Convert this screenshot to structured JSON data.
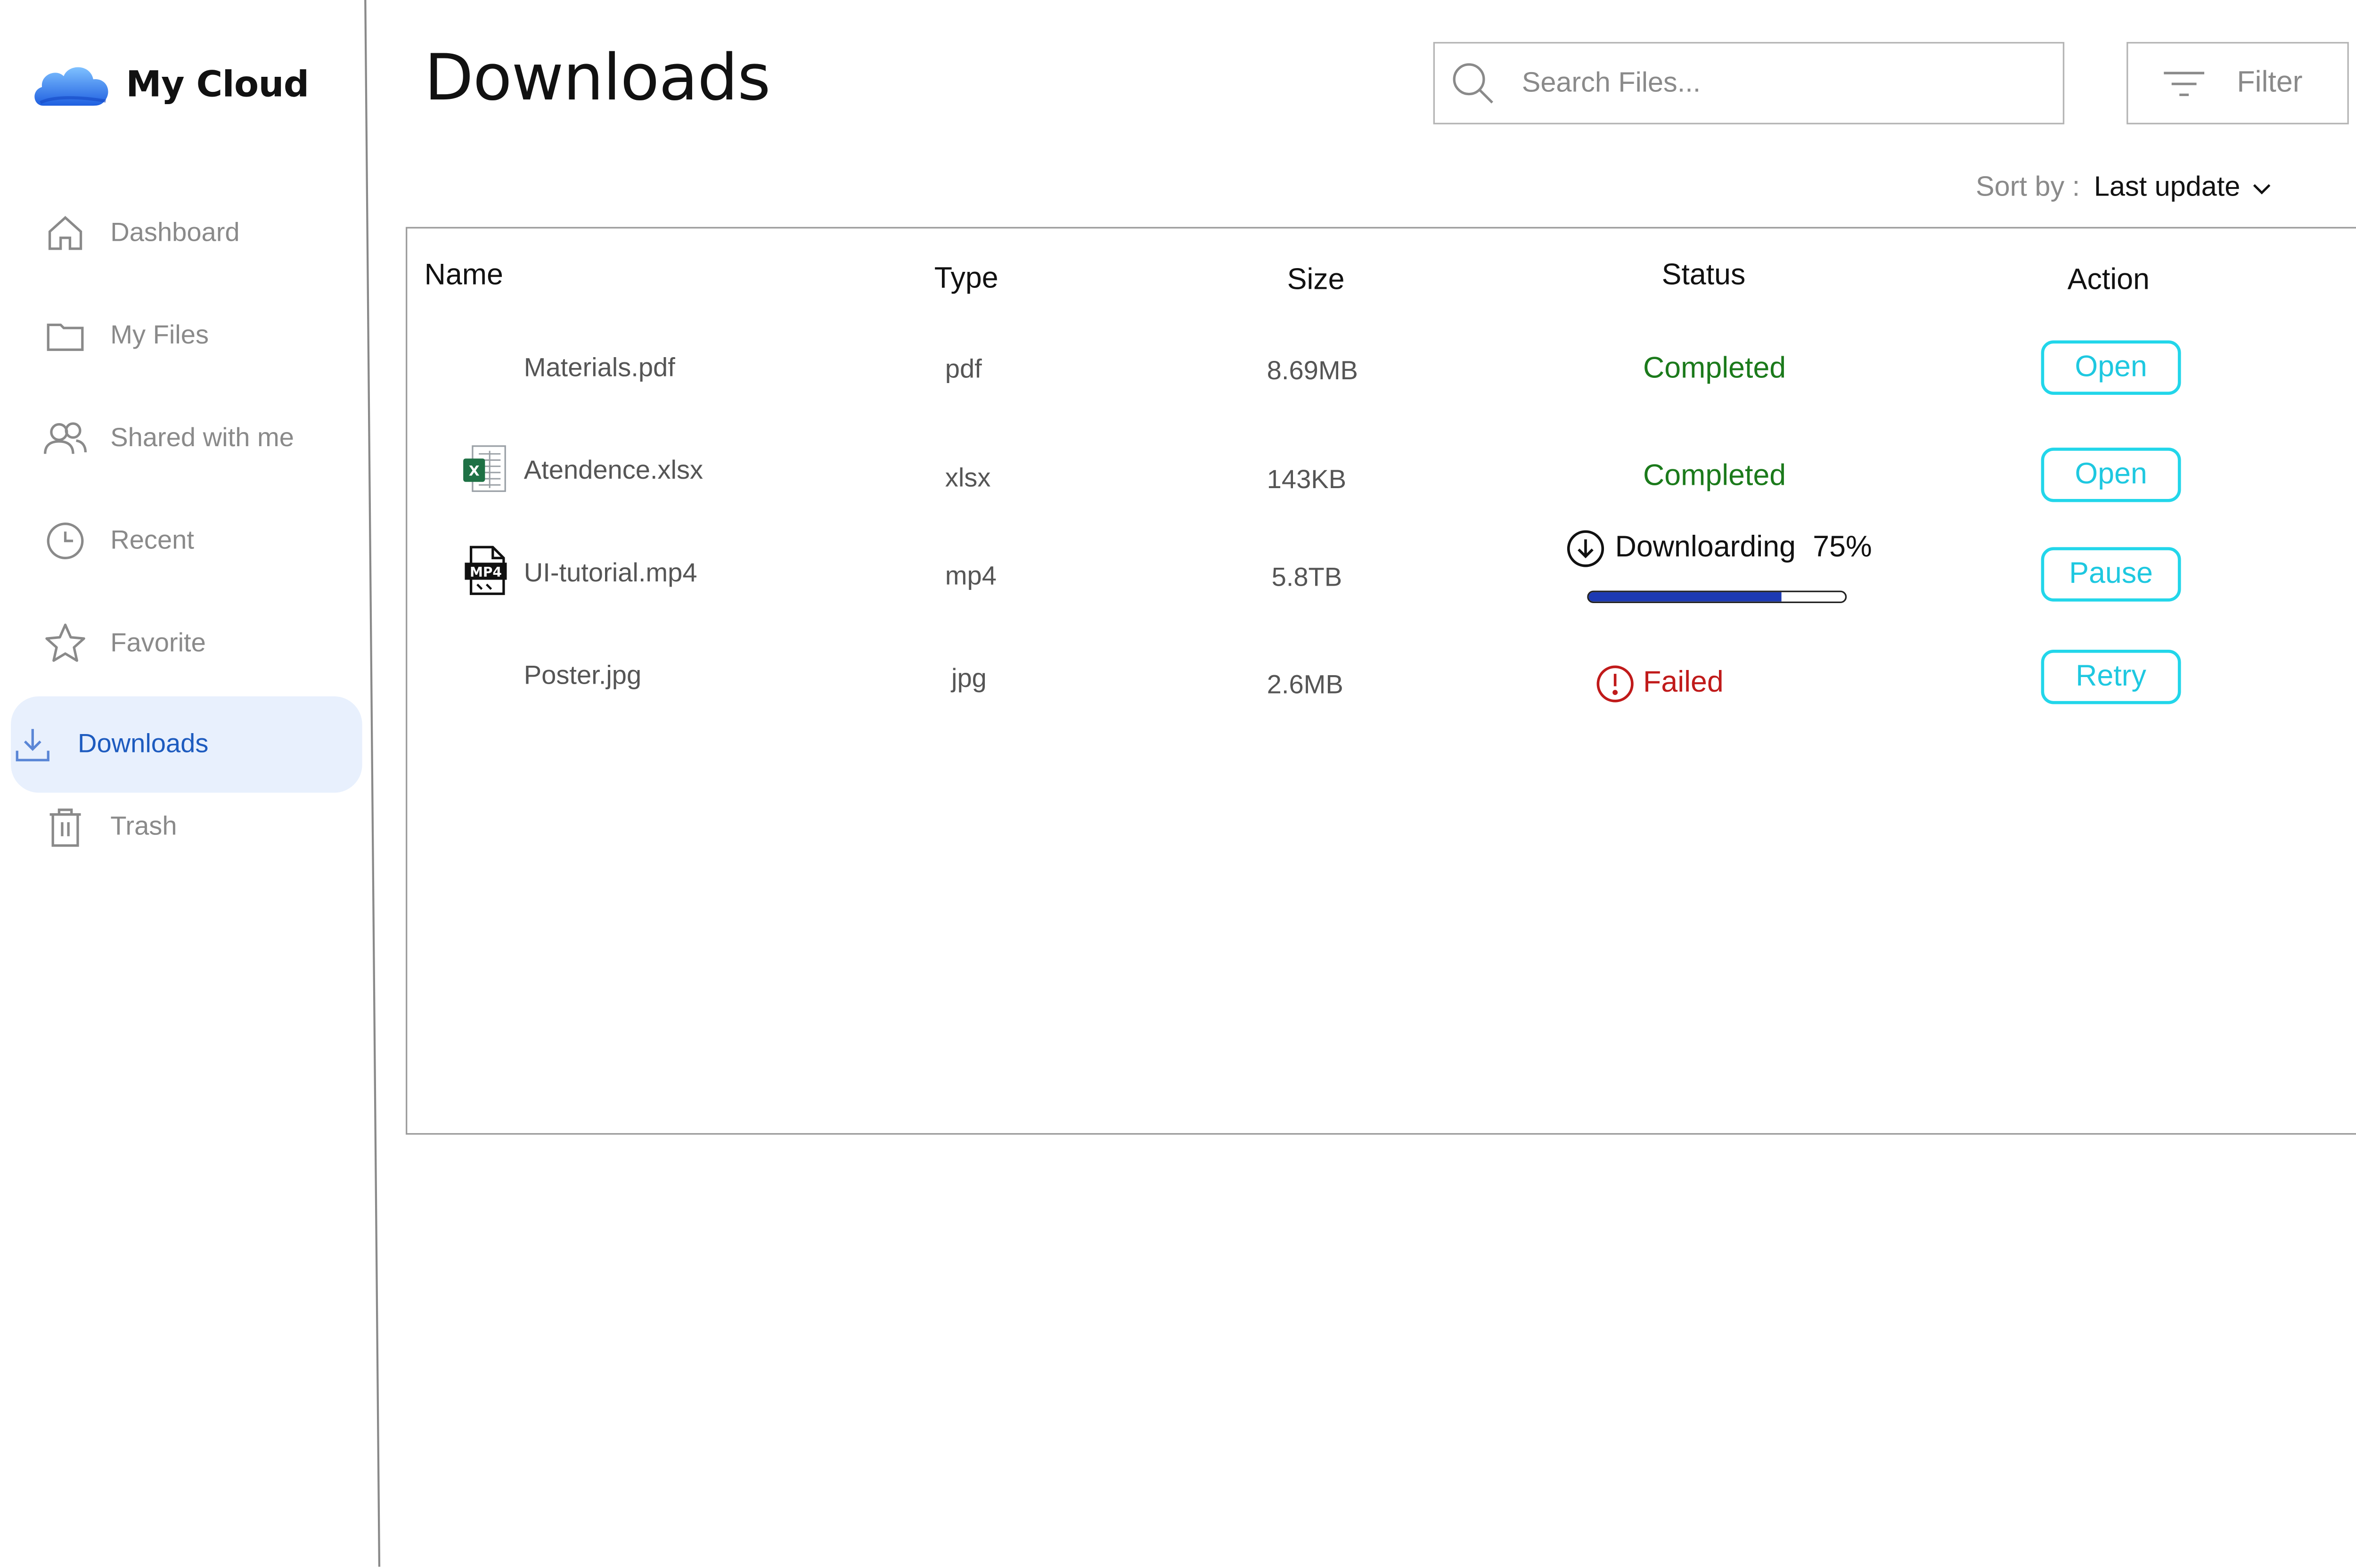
{
  "app": {
    "name": "My Cloud"
  },
  "sidebar": {
    "items": [
      {
        "label": "Dashboard",
        "icon": "home-icon",
        "active": false
      },
      {
        "label": "My Files",
        "icon": "folder-icon",
        "active": false
      },
      {
        "label": "Shared with me",
        "icon": "users-icon",
        "active": false
      },
      {
        "label": "Recent",
        "icon": "clock-icon",
        "active": false
      },
      {
        "label": "Favorite",
        "icon": "star-icon",
        "active": false
      },
      {
        "label": "Downloads",
        "icon": "download-icon",
        "active": true
      },
      {
        "label": "Trash",
        "icon": "trash-icon",
        "active": false
      }
    ]
  },
  "header": {
    "title": "Downloads",
    "search": {
      "placeholder": "Search Files...",
      "value": ""
    },
    "filter_label": "Filter",
    "sort": {
      "label": "Sort by :",
      "value": "Last update"
    }
  },
  "table": {
    "columns": [
      "Name",
      "Type",
      "Size",
      "Status",
      "Action"
    ],
    "rows": [
      {
        "name": "Materials.pdf",
        "icon": "",
        "type": "pdf",
        "size": "8.69MB",
        "status": "Completed",
        "action": "Open"
      },
      {
        "name": "Atendence.xlsx",
        "icon": "excel-file-icon",
        "type": "xlsx",
        "size": "143KB",
        "status": "Completed",
        "action": "Open"
      },
      {
        "name": "UI-tutorial.mp4",
        "icon": "mp4-file-icon",
        "type": "mp4",
        "size": "5.8TB",
        "status": "Downloarding",
        "progress_label": "75%",
        "progress": 0.75,
        "action": "Pause"
      },
      {
        "name": "Poster.jpg",
        "icon": "",
        "type": "jpg",
        "size": "2.6MB",
        "status": "Failed",
        "action": "Retry"
      }
    ]
  },
  "colors": {
    "accent_button": "#22d6ea",
    "completed": "#1b7a1b",
    "failed": "#c01a1a",
    "active_nav_bg": "#e8f0fd",
    "active_nav_text": "#1d5bbf",
    "progress_fill": "#1d3ab3"
  }
}
